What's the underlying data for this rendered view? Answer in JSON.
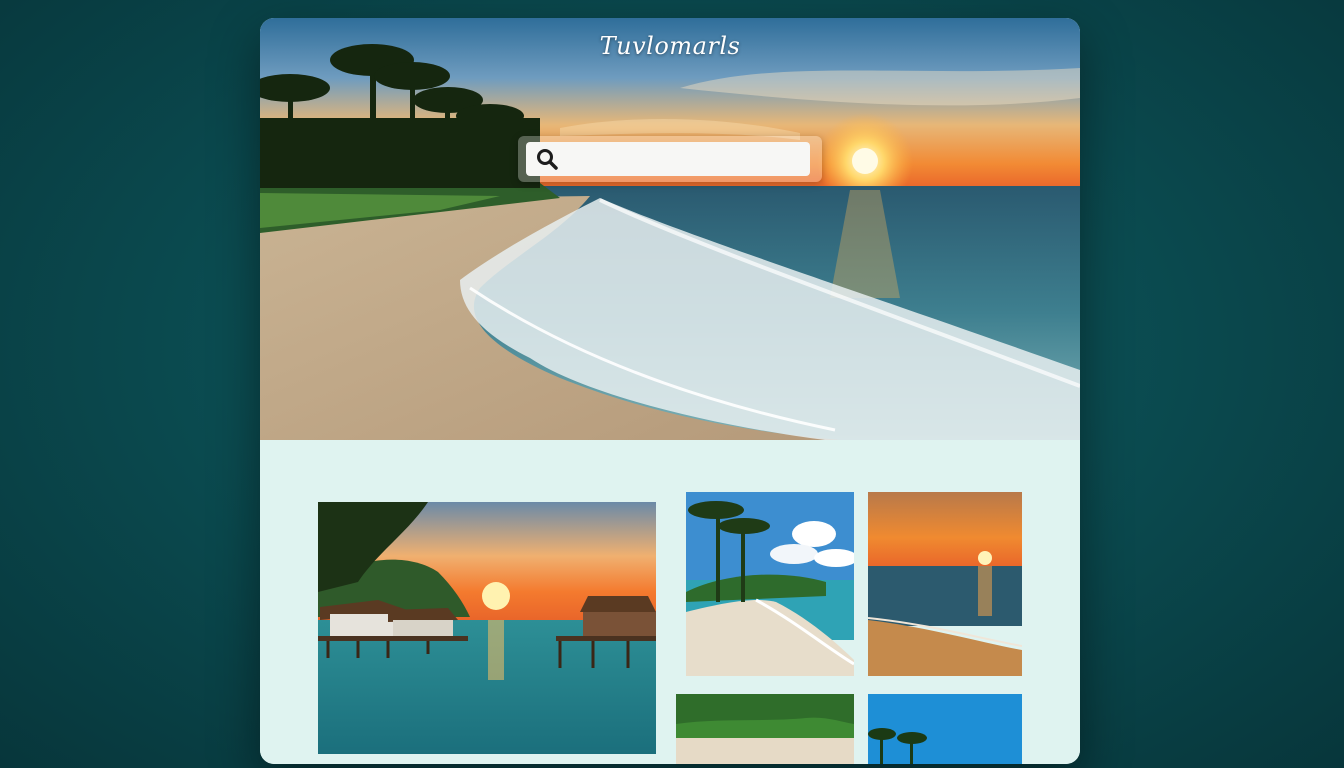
{
  "site": {
    "logo_text": "Tuvlomarls"
  },
  "search": {
    "placeholder": "",
    "value": "",
    "icon": "search-icon"
  },
  "hero": {
    "scene": "sunset-beach-hero"
  },
  "gallery": {
    "tiles": [
      {
        "scene": "overwater-bungalows-sunset"
      },
      {
        "scene": "palm-beach-blue-sky"
      },
      {
        "scene": "ocean-sunset"
      },
      {
        "scene": "jungle-beach"
      },
      {
        "scene": "palm-blue-sky"
      }
    ]
  }
}
